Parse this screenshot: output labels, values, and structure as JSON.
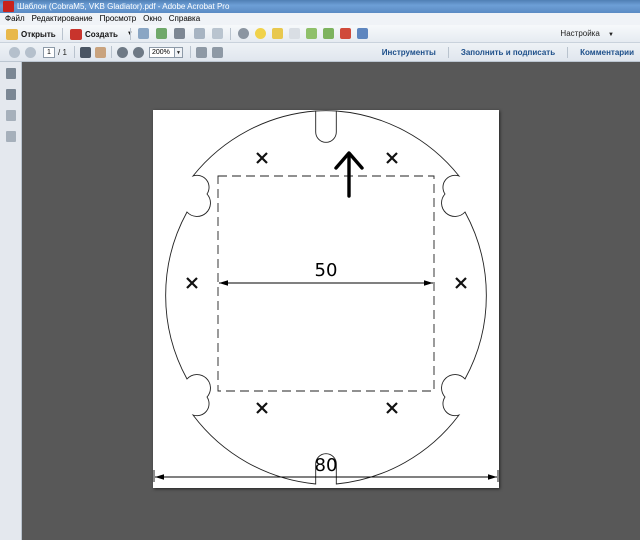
{
  "window": {
    "title": "Шаблон (CobraM5, VKB Gladiator).pdf - Adobe Acrobat Pro"
  },
  "menu": [
    "Файл",
    "Редактирование",
    "Просмотр",
    "Окно",
    "Справка"
  ],
  "toolbar": {
    "open_label": "Открыть",
    "create_label": "Создать",
    "customize_label": "Настройка"
  },
  "navigation": {
    "current_page": "1",
    "total_pages": "/ 1",
    "zoom": "200%"
  },
  "panels": {
    "tools": "Инструменты",
    "fill_sign": "Заполнить и подписать",
    "comments": "Комментарии"
  },
  "drawing": {
    "inner_dimension": "50",
    "outer_dimension": "80"
  }
}
